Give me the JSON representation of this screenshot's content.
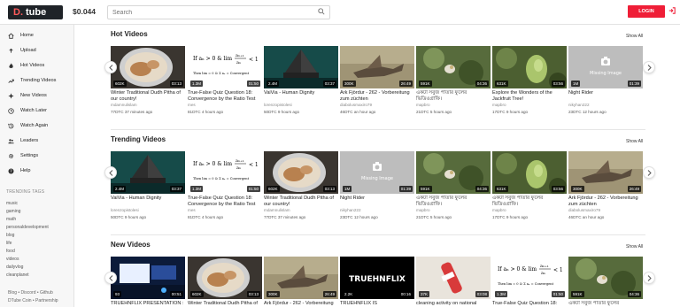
{
  "header": {
    "logo": "tube",
    "logo_d": "D.",
    "balance": "$0.044",
    "search_placeholder": "Search",
    "login_label": "LOGIN"
  },
  "sidebar": {
    "items": [
      {
        "label": "Home",
        "icon": "home-icon"
      },
      {
        "label": "Upload",
        "icon": "upload-icon"
      },
      {
        "label": "Hot Videos",
        "icon": "fire-icon"
      },
      {
        "label": "Trending Videos",
        "icon": "trending-icon"
      },
      {
        "label": "New Videos",
        "icon": "new-icon"
      },
      {
        "label": "Watch Later",
        "icon": "clock-icon"
      },
      {
        "label": "Watch Again",
        "icon": "history-icon"
      },
      {
        "label": "Leaders",
        "icon": "leaders-icon"
      },
      {
        "label": "Settings",
        "icon": "gear-icon"
      },
      {
        "label": "Help",
        "icon": "help-icon"
      }
    ],
    "tags_title": "TRENDING TAGS",
    "tags": [
      "music",
      "gaming",
      "math",
      "personaldevelopment",
      "blog",
      "life",
      "food",
      "videos",
      "dailyvlog",
      "cleanplanet"
    ],
    "footer": [
      "Blog • Discord • Github",
      "DTube Coin • Partnership"
    ]
  },
  "sections": [
    {
      "title": "Hot Videos",
      "show_all": "Show All",
      "videos": [
        {
          "title": "Winter Traditional Dudh Pitha of our country!",
          "author": "mdamnulislam",
          "meta": "77DTC 37 minutes ago",
          "views": "602K",
          "duration": "03:13",
          "thumb": "bowl"
        },
        {
          "title": "True-False Quiz Question 18: Convergence by the Ratio Test",
          "author": "mes",
          "meta": "81DTC 4 hours ago",
          "views": "1.3M",
          "duration": "01:50",
          "thumb": "math"
        },
        {
          "title": "VaiVia - Human Dignity",
          "author": "lorenzopistolesi",
          "meta": "50DTC 9 hours ago",
          "views": "2.4M",
          "duration": "03:37",
          "thumb": "pyramid"
        },
        {
          "title": "Ark Fjördur - 262 - Vorbereitung zum züchten",
          "author": "diabolusmaxiro79",
          "meta": "46DTC an hour ago",
          "views": "300K",
          "duration": "26:49",
          "thumb": "creature"
        },
        {
          "title": "একটা সবুজ পাতার ফুলের ভিডিওগ্রাফি।",
          "author": "mapbro",
          "meta": "21DTC 5 hours ago",
          "views": "591K",
          "duration": "04:36",
          "thumb": "leaf"
        },
        {
          "title": "Explore the Wonders of the Jackfruit Tree!",
          "author": "mapbro",
          "meta": "17DTC 9 hours ago",
          "views": "631K",
          "duration": "03:56",
          "thumb": "jackfruit"
        },
        {
          "title": "Night Rider",
          "author": "nikyhan222",
          "meta": "23DTC 12 hours ago",
          "views": "1M",
          "duration": "01:39",
          "thumb": "missing"
        }
      ]
    },
    {
      "title": "Trending Videos",
      "show_all": "Show All",
      "videos": [
        {
          "title": "VaiVia - Human Dignity",
          "author": "lorenzopistolesi",
          "meta": "50DTC 9 hours ago",
          "views": "2.4M",
          "duration": "03:37",
          "thumb": "pyramid"
        },
        {
          "title": "True-False Quiz Question 18: Convergence by the Ratio Test",
          "author": "mes",
          "meta": "81DTC 4 hours ago",
          "views": "1.3M",
          "duration": "01:50",
          "thumb": "math"
        },
        {
          "title": "Winter Traditional Dudh Pitha of our country!",
          "author": "mdamnulislam",
          "meta": "77DTC 37 minutes ago",
          "views": "602K",
          "duration": "03:13",
          "thumb": "bowl"
        },
        {
          "title": "Night Rider",
          "author": "nikyhan222",
          "meta": "23DTC 12 hours ago",
          "views": "1M",
          "duration": "01:39",
          "thumb": "missing"
        },
        {
          "title": "একটা সবুজ পাতার ফুলের ভিডিওগ্রাফি।",
          "author": "mapbro",
          "meta": "21DTC 5 hours ago",
          "views": "591K",
          "duration": "04:36",
          "thumb": "leaf"
        },
        {
          "title": "একটা সবুজ পাতার ফুলের ভিডিওগ্রাফি।",
          "author": "mapbro",
          "meta": "17DTC 9 hours ago",
          "views": "631K",
          "duration": "03:56",
          "thumb": "jackfruit"
        },
        {
          "title": "Ark Fjördur - 262 - Vorbereitung zum züchten",
          "author": "diabolusmaxiro79",
          "meta": "46DTC an hour ago",
          "views": "300K",
          "duration": "26:49",
          "thumb": "creature"
        }
      ]
    },
    {
      "title": "New Videos",
      "show_all": "Show All",
      "videos": [
        {
          "title": "TRUEHNFLIX PRESENTATION :",
          "author": "",
          "meta": "",
          "views": "93",
          "duration": "00:51",
          "thumb": "stage"
        },
        {
          "title": "Winter Traditional Dudh Pitha of",
          "author": "",
          "meta": "",
          "views": "602K",
          "duration": "03:13",
          "thumb": "bowl"
        },
        {
          "title": "Ark Fjördur - 262 - Vorbereitung",
          "author": "",
          "meta": "",
          "views": "300K",
          "duration": "26:49",
          "thumb": "creature"
        },
        {
          "title": "TRUEHNFLIX IS",
          "author": "",
          "meta": "",
          "views": "2.2K",
          "duration": "00:16",
          "thumb": "logo"
        },
        {
          "title": "cleaning activity on national",
          "author": "",
          "meta": "",
          "views": "37K",
          "duration": "03:08",
          "thumb": "bottle"
        },
        {
          "title": "True-False Quiz Question 18:",
          "author": "",
          "meta": "",
          "views": "1.3M",
          "duration": "01:50",
          "thumb": "math"
        },
        {
          "title": "একটা সবুজ পাতার ফুলের",
          "author": "",
          "meta": "",
          "views": "591K",
          "duration": "04:36",
          "thumb": "leaf"
        }
      ]
    }
  ],
  "thumb_text": {
    "missing": "Missing Image",
    "logo": "TRUEHNFLIX",
    "math_line1": "If a_n > 0 & lim a_{n+1}/a_n < 1",
    "math_line2": "Then lim ... = 0 & Σ a_n = Convergent"
  },
  "colors": {
    "accent": "#ef1e37",
    "logo_bg": "#1f2328"
  }
}
